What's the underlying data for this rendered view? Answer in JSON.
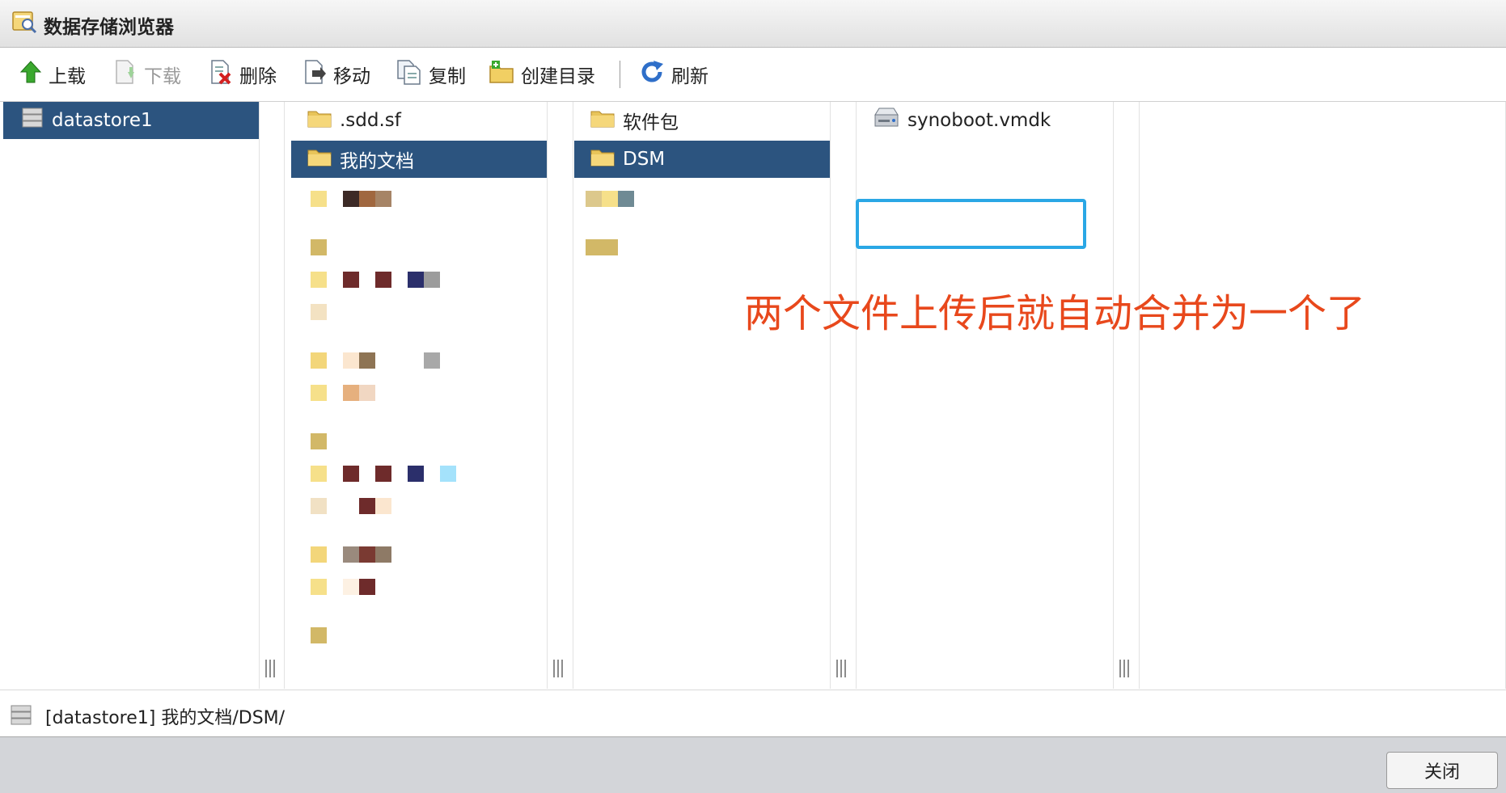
{
  "window": {
    "title": "数据存储浏览器",
    "app_icon": "datastore-browser-icon"
  },
  "toolbar": {
    "upload": "上载",
    "download": "下载",
    "delete": "删除",
    "move": "移动",
    "copy": "复制",
    "create_dir": "创建目录",
    "refresh": "刷新"
  },
  "pane1": {
    "items": [
      {
        "label": "datastore1",
        "selected": true,
        "icon": "datastore-icon"
      }
    ]
  },
  "pane2": {
    "items": [
      {
        "label": ".sdd.sf",
        "selected": false,
        "icon": "folder-icon"
      },
      {
        "label": "我的文档",
        "selected": true,
        "icon": "folder-icon"
      }
    ]
  },
  "pane3": {
    "items": [
      {
        "label": "软件包",
        "selected": false,
        "icon": "folder-icon"
      },
      {
        "label": "DSM",
        "selected": true,
        "icon": "folder-icon"
      }
    ]
  },
  "pane4": {
    "items": [
      {
        "label": "synoboot.vmdk",
        "selected": false,
        "icon": "disk-file-icon"
      }
    ]
  },
  "annotation": "两个文件上传后就自动合并为一个了",
  "statusbar": {
    "path": "[datastore1] 我的文档/DSM/"
  },
  "footer": {
    "close": "关闭"
  },
  "colors": {
    "selection": "#2c547f",
    "highlight_border": "#2aa7e5",
    "annotation": "#e8481c"
  }
}
